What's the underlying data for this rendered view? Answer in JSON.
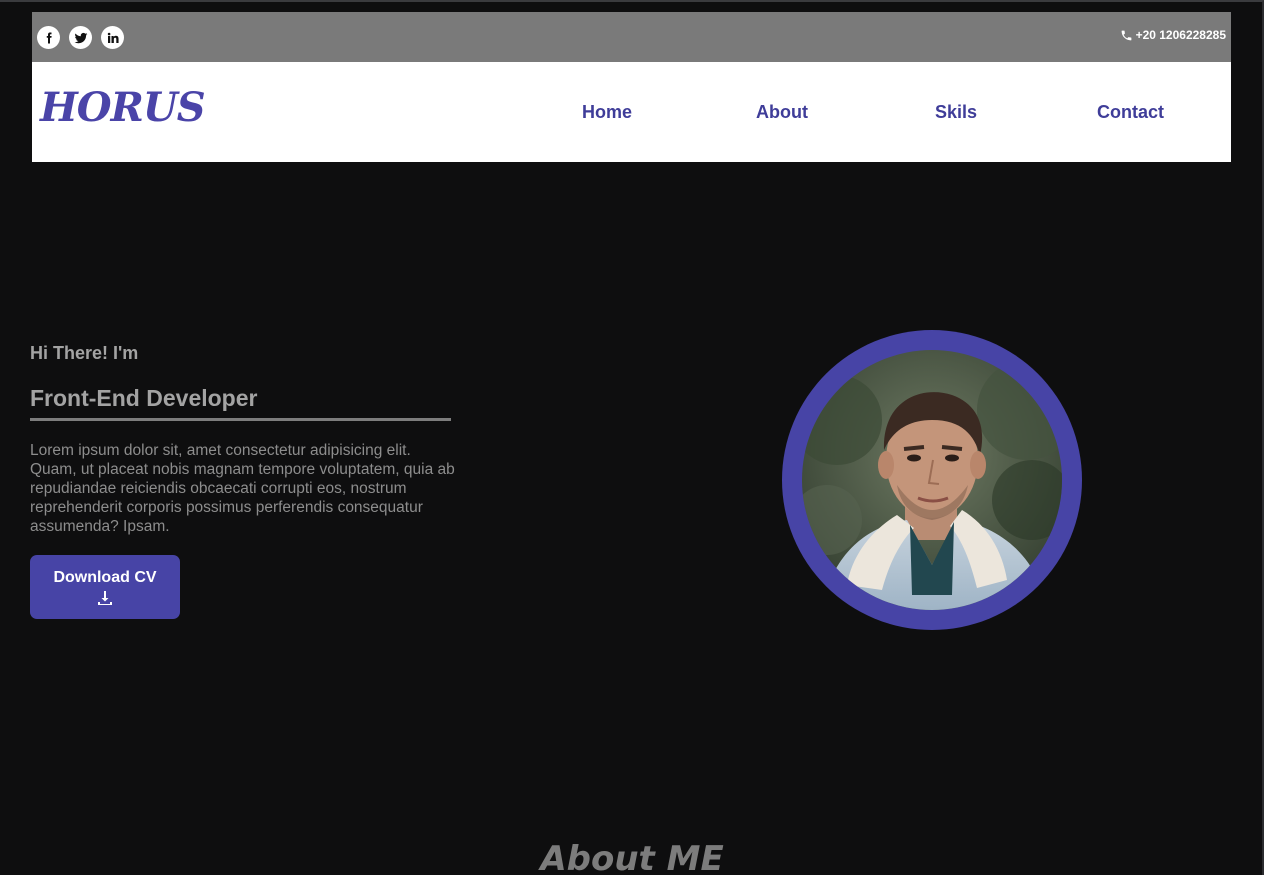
{
  "topbar": {
    "social": [
      {
        "name": "facebook-icon",
        "glyph": "f"
      },
      {
        "name": "twitter-icon",
        "glyph": "twitter"
      },
      {
        "name": "linkedin-icon",
        "glyph": "in"
      }
    ],
    "phone": "+20 1206228285",
    "phone_icon": "phone-icon"
  },
  "navbar": {
    "logo": "HORUS",
    "links": [
      "Home",
      "About",
      "Skils",
      "Contact"
    ]
  },
  "hero": {
    "greeting": "Hi There! I'm",
    "title": "Front-End Developer",
    "description": "Lorem ipsum dolor sit, amet consectetur adipisicing elit. Quam, ut placeat nobis magnam tempore voluptatem, quia ab repudiandae reiciendis obcaecati corrupti eos, nostrum reprehenderit corporis possimus perferendis consequatur assumenda? Ipsam.",
    "button_label": "Download CV",
    "button_icon": "download-icon"
  },
  "about": {
    "heading": "About ME"
  },
  "colors": {
    "accent": "#4744a6",
    "background": "#0e0e0f",
    "topbar": "#7a7a7a",
    "text_muted": "#a3a3a3"
  }
}
